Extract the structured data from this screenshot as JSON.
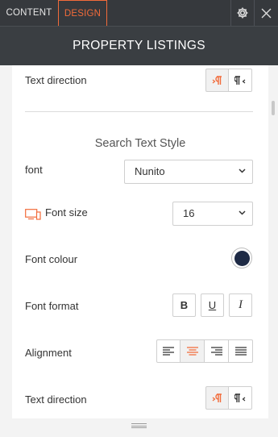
{
  "tabs": [
    {
      "label": "CONTENT"
    },
    {
      "label": "DESIGN"
    }
  ],
  "header": {
    "title": "PROPERTY LISTINGS"
  },
  "colors": {
    "accent": "#f26b3a",
    "topbar": "#36393d",
    "font_colour": "#1e2a45"
  },
  "panel": {
    "text_direction_label": "Text direction",
    "section_title": "Search Text Style",
    "font": {
      "label": "font",
      "value": "Nunito"
    },
    "font_size": {
      "label": "Font size",
      "value": "16"
    },
    "font_colour": {
      "label": "Font colour"
    },
    "font_format": {
      "label": "Font format",
      "bold": "B",
      "underline": "U",
      "italic": "I"
    },
    "alignment": {
      "label": "Alignment",
      "selected": "center"
    },
    "text_direction_2_label": "Text direction"
  },
  "icons": [
    "gear-icon",
    "close-icon",
    "ltr-icon",
    "rtl-icon",
    "device-icon",
    "chevron-down-icon",
    "align-left-icon",
    "align-center-icon",
    "align-right-icon",
    "align-justify-icon"
  ]
}
